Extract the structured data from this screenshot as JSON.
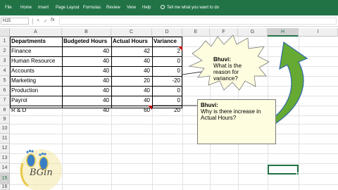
{
  "ribbon": {
    "tabs": [
      "File",
      "Home",
      "Insert",
      "Page Layout",
      "Formulas",
      "Review",
      "View",
      "Help"
    ],
    "tell_me": "Tell me what you want to do"
  },
  "formula_bar": {
    "name_box": "H15",
    "cancel_glyph": "×",
    "enter_glyph": "✓",
    "fx_label": "fx",
    "formula": ""
  },
  "grid": {
    "columns": [
      "A",
      "B",
      "C",
      "D",
      "E",
      "F",
      "G",
      "H",
      "I"
    ],
    "active_column": "H",
    "rows": [
      "1",
      "2",
      "3",
      "4",
      "5",
      "6",
      "7",
      "8",
      "9",
      "10",
      "11",
      "12",
      "13",
      "14",
      "15",
      "16"
    ],
    "active_row": "15"
  },
  "table": {
    "headers": [
      "Departments",
      "Budgeted Hours",
      "Actual Hours",
      "Variance"
    ],
    "rows": [
      [
        "Finance",
        "40",
        "42",
        "2"
      ],
      [
        "Human Resource",
        "40",
        "40",
        "0"
      ],
      [
        "Accounts",
        "40",
        "40",
        "0"
      ],
      [
        "Marketing",
        "40",
        "20",
        "-20"
      ],
      [
        "Production",
        "40",
        "40",
        "0"
      ],
      [
        "Payrol",
        "40",
        "40",
        "0"
      ],
      [
        "R & D",
        "40",
        "60",
        "20"
      ]
    ]
  },
  "comments": {
    "variance": {
      "author": "Bhuvi:",
      "text": "What is the reason for variance?"
    },
    "actual_hours": {
      "author": "Bhuvi:",
      "text": "Why is there increase in Actual Hours?"
    }
  },
  "logo": {
    "text": "BGin"
  },
  "colors": {
    "ribbon": "#217346",
    "comment_fill": "#fffde0",
    "arrow_fill": "#66aa33",
    "arrow_outline": "#2f6aa8",
    "logo_gold": "#e8c84a",
    "logo_blue": "#3a7fc6"
  }
}
